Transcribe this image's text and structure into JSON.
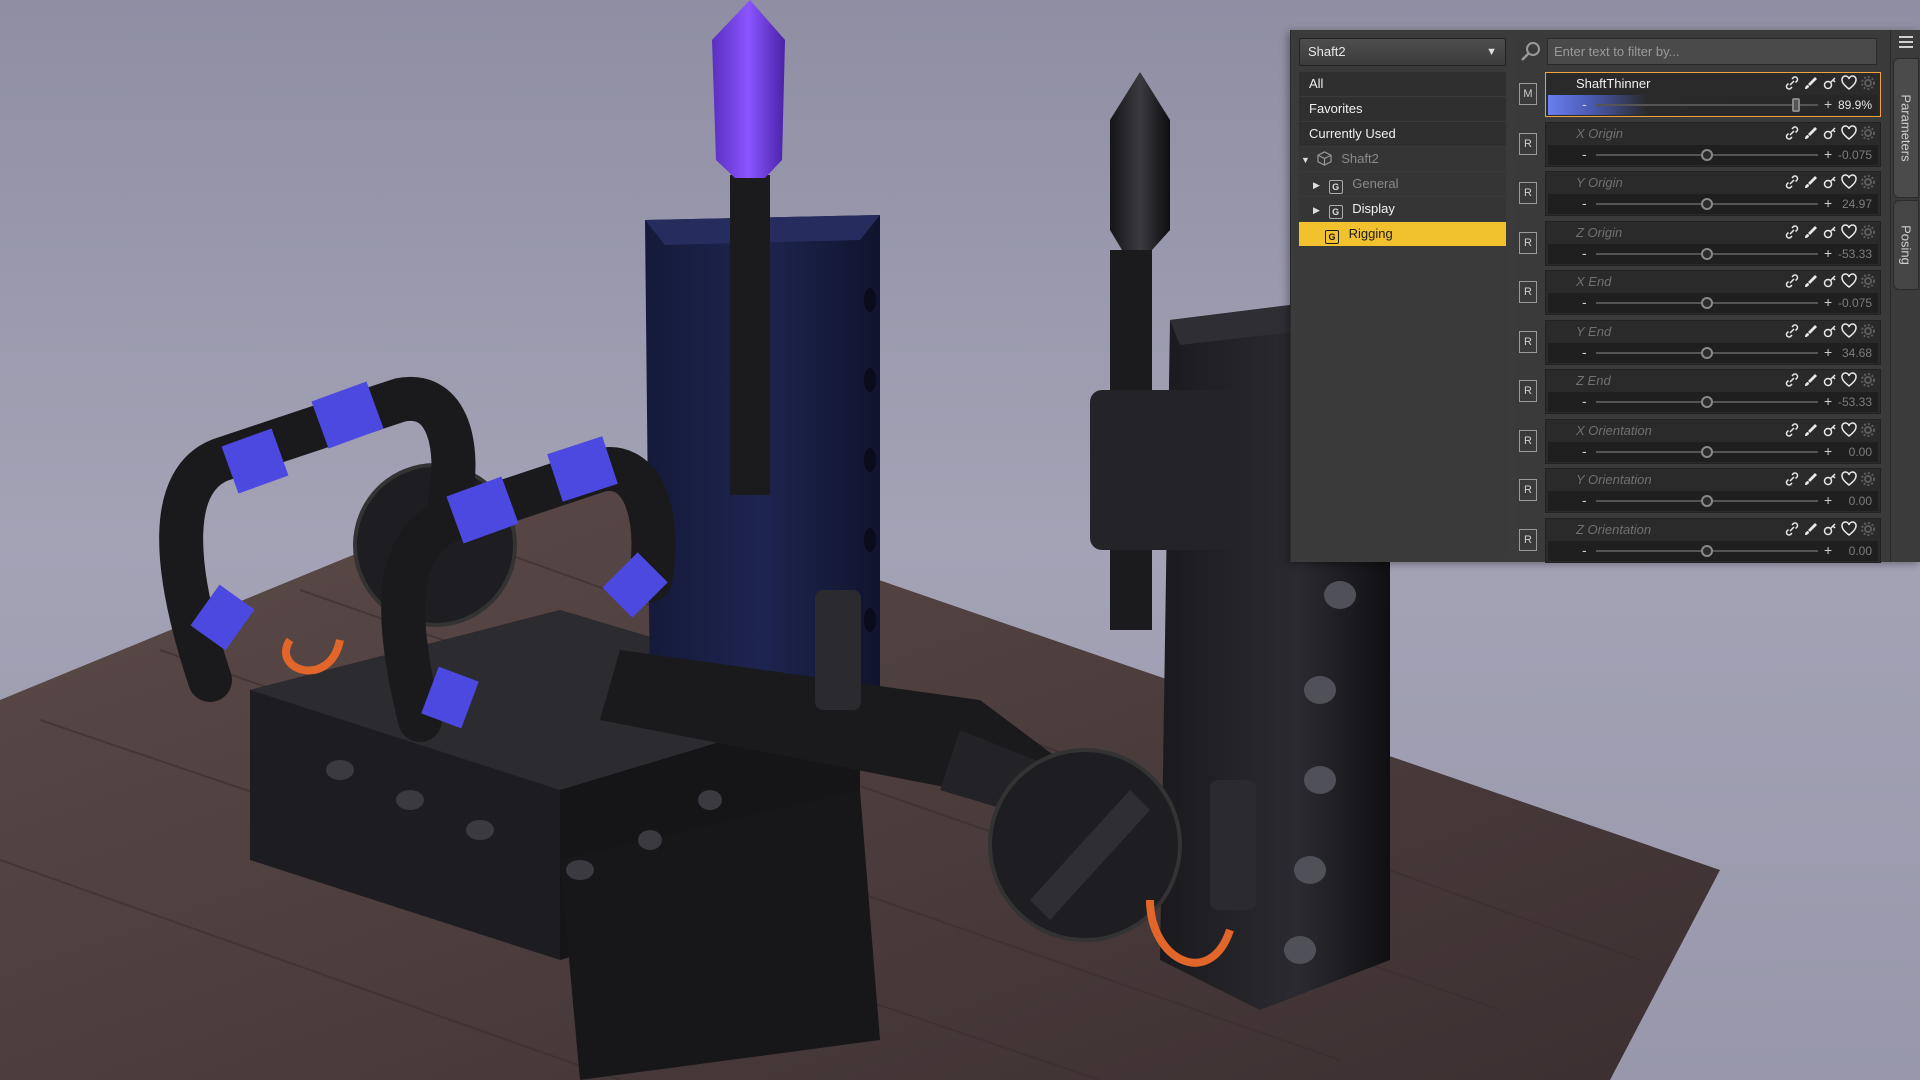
{
  "node_selector": {
    "selected": "Shaft2"
  },
  "filter": {
    "placeholder": "Enter text to filter by..."
  },
  "groups": [
    {
      "label": "All"
    },
    {
      "label": "Favorites"
    },
    {
      "label": "Currently Used"
    },
    {
      "label": "Shaft2"
    },
    {
      "label": "General",
      "icon_letter": "G"
    },
    {
      "label": "Display",
      "icon_letter": "G"
    },
    {
      "label": "Rigging",
      "icon_letter": "G"
    }
  ],
  "parameters": [
    {
      "mode": "M",
      "name": "ShaftThinner",
      "value": "89.9%",
      "level": 0.899,
      "active": true
    },
    {
      "mode": "R",
      "name": "X Origin",
      "value": "-0.075",
      "level": 0.5
    },
    {
      "mode": "R",
      "name": "Y Origin",
      "value": "24.97",
      "level": 0.5
    },
    {
      "mode": "R",
      "name": "Z Origin",
      "value": "-53.33",
      "level": 0.5
    },
    {
      "mode": "R",
      "name": "X End",
      "value": "-0.075",
      "level": 0.5
    },
    {
      "mode": "R",
      "name": "Y End",
      "value": "34.68",
      "level": 0.5
    },
    {
      "mode": "R",
      "name": "Z End",
      "value": "-53.33",
      "level": 0.5
    },
    {
      "mode": "R",
      "name": "X Orientation",
      "value": "0.00",
      "level": 0.5
    },
    {
      "mode": "R",
      "name": "Y Orientation",
      "value": "0.00",
      "level": 0.5
    },
    {
      "mode": "R",
      "name": "Z Orientation",
      "value": "0.00",
      "level": 0.5
    }
  ],
  "side_tabs": [
    {
      "label": "Parameters",
      "active": true
    },
    {
      "label": "Posing"
    }
  ],
  "slider_controls": {
    "minus": "-",
    "plus": "+"
  },
  "colors": {
    "selected_group": "#f2c12e",
    "active_slider_gradient": "#6a7ff0",
    "active_outline": "#f2a23a"
  }
}
